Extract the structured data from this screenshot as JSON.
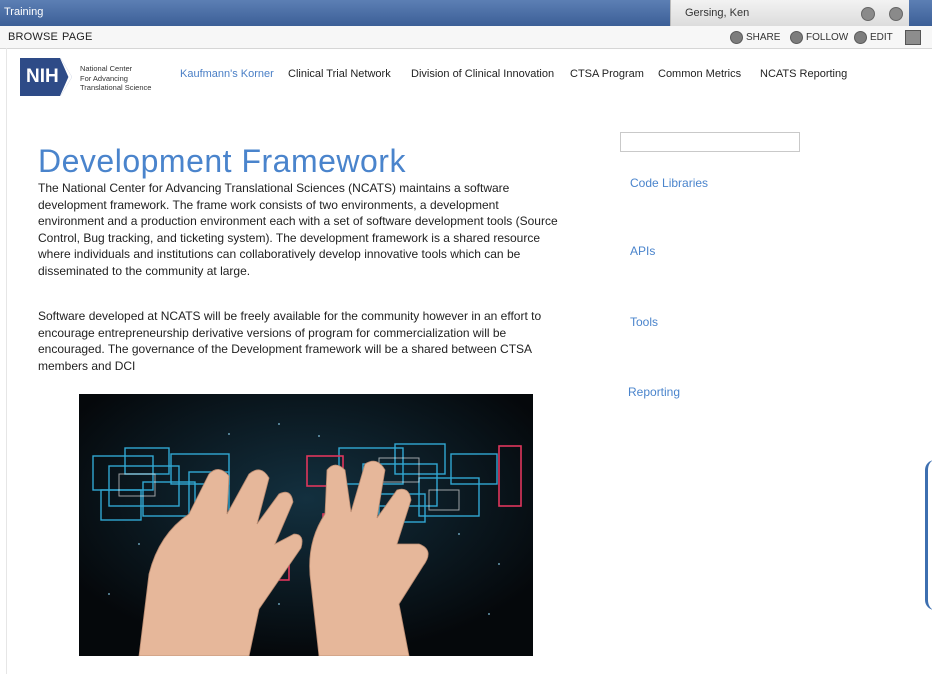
{
  "suite": {
    "site_title": "Training",
    "user_name": "Gersing, Ken"
  },
  "ribbon": {
    "tabs": [
      "BROWSE",
      "PAGE"
    ],
    "actions": [
      "SHARE",
      "FOLLOW",
      "EDIT"
    ]
  },
  "brand": {
    "logo_text": "NIH",
    "org_lines": [
      "National Center",
      "For Advancing",
      "Translational Science"
    ]
  },
  "nav": {
    "items": [
      "Kaufmann's Korner",
      "Clinical Trial Network",
      "Division of Clinical Innovation",
      "CTSA Program",
      "Common Metrics",
      "NCATS Reporting"
    ],
    "active_index": 0
  },
  "main": {
    "title": "Development Framework",
    "paragraphs": [
      "The National Center for Advancing Translational Sciences (NCATS) maintains a software development framework. The frame work consists of two environments, a development environment and a production environment each with a set of software development tools (Source Control, Bug tracking, and ticketing system). The development framework is a shared resource where individuals and institutions can collaboratively develop innovative tools which can be disseminated to the community at large.",
      "Software developed at NCATS will be freely available for the community however in an effort to encourage entrepreneurship derivative versions of program for commercialization will be encouraged.  The governance of the Development framework will be a shared between CTSA members and DCI"
    ]
  },
  "sidebar": {
    "search_value": "",
    "links": [
      "Code Libraries",
      "APIs",
      "Tools",
      "Reporting"
    ]
  },
  "colors": {
    "suite_bar": "#3c5f97",
    "accent_link": "#4a84cc",
    "nih_blue": "#2e4b87"
  }
}
